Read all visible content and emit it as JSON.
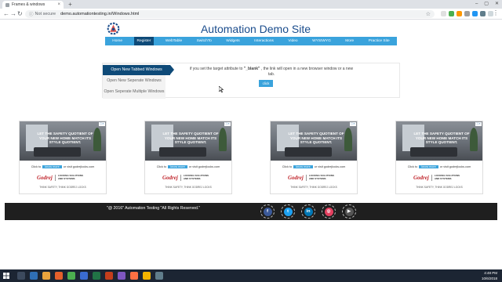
{
  "browser": {
    "tab_title": "Frames & windows",
    "tab_close": "×",
    "new_tab": "+",
    "window_controls": [
      "–",
      "▢",
      "✕"
    ],
    "nav_back": "←",
    "nav_forward": "→",
    "nav_reload": "↻",
    "omnibox_info": "ⓘ",
    "omnibox_security": "Not secure",
    "url": "demo.automationtesting.in/Windows.html",
    "star": "☆",
    "menu": "⋮"
  },
  "header": {
    "site_title": "Automation Demo Site"
  },
  "nav": {
    "items": [
      "Home",
      "Register",
      "WebTable",
      "SwitchTo",
      "Widgets",
      "Interactions",
      "Video",
      "WYSIWYG",
      "More",
      "Practice Site"
    ],
    "active_index": 1
  },
  "tabs_panel": {
    "tabs": [
      "Open New Tabbed Windows",
      "Open New Seperate Windows",
      "Open Seperate Multiple Windows"
    ],
    "active_index": 0,
    "description_prefix": "if you set the target attribute to ",
    "description_code": "\"_blank\"",
    "description_suffix": " , the link will open in a new browser window or a new tab.",
    "button_label": "click"
  },
  "ad": {
    "headline": "LET THE SAFETY QUOTIENT OF YOUR NEW HOME MATCH ITS STYLE QUOTIENT.",
    "badge": "ⓘ✕",
    "click_prefix": "Click to",
    "click_button": "know more",
    "click_suffix": "or visit godrejlocks.com",
    "brand": "Godrej",
    "brand_sub_1": "LOCKING SOLUTIONS",
    "brand_sub_2": "AND SYSTEMS",
    "tagline": "THINK SAFETY, THINK GODREJ LOCKS"
  },
  "footer": {
    "copyright": "\"@ 2016\" Automation Testing \"All Rights Reserved.\"",
    "social": [
      {
        "icon": "facebook-icon",
        "glyph": "f",
        "color": "#3b5998"
      },
      {
        "icon": "twitter-icon",
        "glyph": "t",
        "color": "#1da1f2"
      },
      {
        "icon": "linkedin-icon",
        "glyph": "in",
        "color": "#0077b5"
      },
      {
        "icon": "instagram-icon",
        "glyph": "◎",
        "color": "#e4405f"
      },
      {
        "icon": "youtube-icon",
        "glyph": "▶",
        "color": "#555555"
      }
    ]
  },
  "taskbar": {
    "time": "4:48 PM",
    "date": "10/6/2018"
  },
  "colors": {
    "primary": "#3aa3dc",
    "navy": "#0e4a78",
    "title": "#1a4c8c",
    "footer": "#1f1f1f"
  }
}
